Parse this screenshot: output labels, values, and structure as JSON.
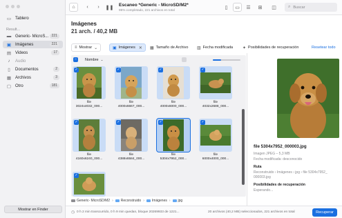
{
  "sidebar": {
    "top_item": {
      "label": "Tablero",
      "icon": "dashboard-icon"
    },
    "section_heading": "Result...",
    "items": [
      {
        "label": "Generic- MicroS...",
        "count": "221",
        "icon": "drive-icon"
      },
      {
        "label": "Imágenes",
        "count": "221",
        "icon": "image-icon"
      },
      {
        "label": "Videos",
        "count": "17",
        "icon": "video-icon"
      },
      {
        "label": "Audio",
        "count": "",
        "icon": "music-note-icon"
      },
      {
        "label": "Documentos",
        "count": "2",
        "icon": "document-icon"
      },
      {
        "label": "Archivos",
        "count": "3",
        "icon": "archive-icon"
      },
      {
        "label": "Otro",
        "count": "181",
        "icon": "other-files-icon"
      }
    ],
    "finder_button": "Mostrar en Finder"
  },
  "toolbar": {
    "title": "Escaneo *Generic - MicroSD/M2*",
    "subtitle": "95% completado, 221 archivos en total",
    "search_placeholder": "Buscar"
  },
  "header": {
    "title": "Imágenes",
    "subtitle": "21 arch. / 40,2 MB"
  },
  "filters": {
    "show_label": "Mostrar",
    "active_filter": "Imágenes",
    "size_filter": "Tamaño de Archivo",
    "date_filter": "Fecha modificada",
    "chance_filter": "Posibilidades de recuperación",
    "reset_label": "Resetear todo"
  },
  "list": {
    "name_header": "Nombre",
    "zoom_level": 0.3,
    "tiles": [
      {
        "name": "file",
        "dims": "3024x4032_000...",
        "selected": false
      },
      {
        "name": "file",
        "dims": "4000x6667_000...",
        "selected": false
      },
      {
        "name": "file",
        "dims": "4000x6000_000...",
        "selected": false
      },
      {
        "name": "file",
        "dims": "4032x2688_000...",
        "selected": false
      },
      {
        "name": "file",
        "dims": "4160x6240_000...",
        "selected": false
      },
      {
        "name": "file",
        "dims": "4388x6584_000...",
        "selected": false
      },
      {
        "name": "file",
        "dims": "5304x7952_000...",
        "selected": true
      },
      {
        "name": "file",
        "dims": "6000x4000_000...",
        "selected": false
      },
      {
        "name": "",
        "dims": "",
        "selected": false
      }
    ]
  },
  "breadcrumb": [
    "Generic- MicroSD/M2",
    "Reconstruido",
    "Imágenes",
    "jpg"
  ],
  "preview": {
    "filename": "file 5304x7952_000003.jpg",
    "type_size": "Imagen JPEG – 5,3 MB",
    "modified": "Fecha modificada: desconocido",
    "route_heading": "Ruta",
    "route_value_1": "Reconstruido › Imágenes › jpg › file 5304x7952_",
    "route_value_2": "000003.jpg",
    "chance_heading": "Posibilidades de recuperación",
    "chance_value": "Esperando..."
  },
  "status": {
    "left": "0 h 2 min transcurrido, 0 h 9 min quedan, bloque 20269933 de 1221...",
    "right": "20 archivos (40,2 MB) seleccionados, 221 archivos en total",
    "recover_label": "Recuperar"
  },
  "colors": {
    "accent": "#1a6fe0",
    "sidebar_bg": "#f2f2f4",
    "tile_bg": "#c9dcf6"
  }
}
